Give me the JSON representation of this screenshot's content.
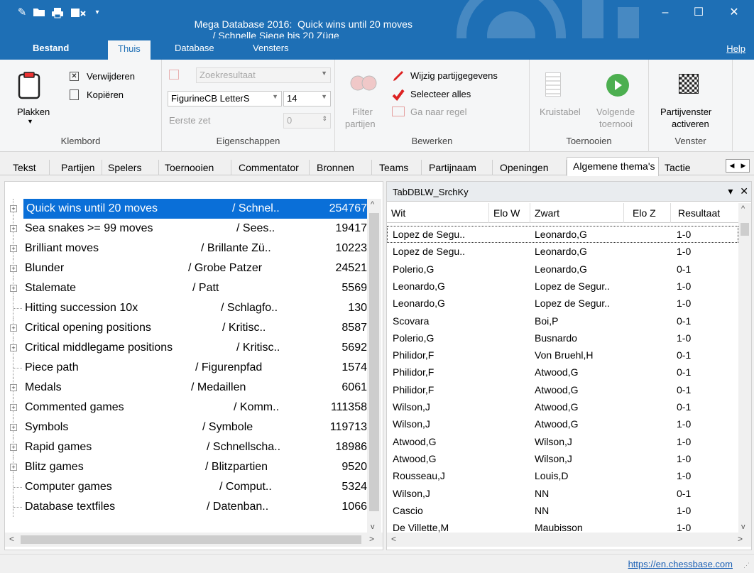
{
  "window": {
    "title": "Mega Database 2016:  Quick wins until 20 moves",
    "title_suffix": "/ Schnelle Siege bis 20 Züge",
    "minimize": "–",
    "maximize": "☐",
    "close": "✕"
  },
  "quick_access": {
    "edit_icon": "✎",
    "open_icon": "📂",
    "print_icon": "🖶",
    "more_icon": "▾"
  },
  "menu": {
    "tabs": [
      "Bestand",
      "Thuis",
      "Database",
      "Vensters"
    ],
    "active": "Thuis",
    "help": "Help"
  },
  "ribbon": {
    "clipboard": {
      "paste": "Plakken",
      "delete": "Verwijderen",
      "copy": "Kopiëren",
      "group": "Klembord"
    },
    "properties": {
      "search_result": "Zoekresultaat",
      "font": "FigurineCB LetterS",
      "font_size": "14",
      "first_move": "Eerste zet",
      "first_move_value": "0",
      "group": "Eigenschappen"
    },
    "edit": {
      "filter_line1": "Filter",
      "filter_line2": "partijen",
      "edit_game_data": "Wijzig partijgegevens",
      "select_all": "Selecteer alles",
      "goto_line": "Ga naar regel",
      "group": "Bewerken"
    },
    "tournaments": {
      "crosstable": "Kruistabel",
      "next_line1": "Volgende",
      "next_line2": "toernooi",
      "group": "Toernooien"
    },
    "window": {
      "activate_line1": "Partijvenster",
      "activate_line2": "activeren",
      "group": "Venster"
    }
  },
  "content_tabs": [
    "Tekst",
    "Partijen",
    "Spelers",
    "Toernooien",
    "Commentator",
    "Bronnen",
    "Teams",
    "Partijnaam",
    "Openingen",
    "Algemene thema's",
    "Tactie"
  ],
  "active_content_tab": "Algemene thema's",
  "tree": [
    {
      "name": "Quick wins until 20 moves",
      "de": "/ Schnel..",
      "count": "254767",
      "expandable": true,
      "selected": true
    },
    {
      "name": "Sea snakes >= 99 moves",
      "de": "/ Sees..",
      "count": "19417",
      "expandable": true
    },
    {
      "name": "Brilliant moves",
      "de": "/ Brillante Zü..",
      "count": "10223",
      "expandable": true
    },
    {
      "name": "Blunder",
      "de": "/ Grobe Patzer",
      "count": "24521",
      "expandable": true
    },
    {
      "name": "Stalemate",
      "de": "/ Patt",
      "count": "5569",
      "expandable": true
    },
    {
      "name": "Hitting succession 10x",
      "de": "/ Schlagfo..",
      "count": "130",
      "expandable": false
    },
    {
      "name": "Critical opening positions",
      "de": "/ Kritisc..",
      "count": "8587",
      "expandable": true
    },
    {
      "name": "Critical middlegame positions",
      "de": "/ Kritisc..",
      "count": "5692",
      "expandable": true
    },
    {
      "name": "Piece path",
      "de": "/ Figurenpfad",
      "count": "1574",
      "expandable": false
    },
    {
      "name": "Medals",
      "de": "/ Medaillen",
      "count": "6061",
      "expandable": true
    },
    {
      "name": "Commented games",
      "de": "/ Komm..",
      "count": "111358",
      "expandable": true
    },
    {
      "name": "Symbols",
      "de": "/ Symbole",
      "count": "119713",
      "expandable": true
    },
    {
      "name": "Rapid games",
      "de": "/ Schnellscha..",
      "count": "18986",
      "expandable": true
    },
    {
      "name": "Blitz games",
      "de": "/ Blitzpartien",
      "count": "9520",
      "expandable": true
    },
    {
      "name": "Computer games",
      "de": "/ Comput..",
      "count": "5324",
      "expandable": false
    },
    {
      "name": "Database textfiles",
      "de": "/ Datenban..",
      "count": "1066",
      "expandable": false
    }
  ],
  "games_panel": {
    "title": "TabDBLW_SrchKy",
    "columns": [
      "Wit",
      "Elo W",
      "Zwart",
      "Elo Z",
      "Resultaat"
    ],
    "rows": [
      [
        "Lopez de Segu..",
        "",
        "Leonardo,G",
        "",
        "1-0"
      ],
      [
        "Lopez de Segu..",
        "",
        "Leonardo,G",
        "",
        "1-0"
      ],
      [
        "Polerio,G",
        "",
        "Leonardo,G",
        "",
        "0-1"
      ],
      [
        "Leonardo,G",
        "",
        "Lopez de Segur..",
        "",
        "1-0"
      ],
      [
        "Leonardo,G",
        "",
        "Lopez de Segur..",
        "",
        "1-0"
      ],
      [
        "Scovara",
        "",
        "Boi,P",
        "",
        "0-1"
      ],
      [
        "Polerio,G",
        "",
        "Busnardo",
        "",
        "1-0"
      ],
      [
        "Philidor,F",
        "",
        "Von Bruehl,H",
        "",
        "0-1"
      ],
      [
        "Philidor,F",
        "",
        "Atwood,G",
        "",
        "0-1"
      ],
      [
        "Philidor,F",
        "",
        "Atwood,G",
        "",
        "0-1"
      ],
      [
        "Wilson,J",
        "",
        "Atwood,G",
        "",
        "0-1"
      ],
      [
        "Wilson,J",
        "",
        "Atwood,G",
        "",
        "1-0"
      ],
      [
        "Atwood,G",
        "",
        "Wilson,J",
        "",
        "1-0"
      ],
      [
        "Atwood,G",
        "",
        "Wilson,J",
        "",
        "1-0"
      ],
      [
        "Rousseau,J",
        "",
        "Louis,D",
        "",
        "1-0"
      ],
      [
        "Wilson,J",
        "",
        "NN",
        "",
        "0-1"
      ],
      [
        "Cascio",
        "",
        "NN",
        "",
        "1-0"
      ],
      [
        "De Villette,M",
        "",
        "Maubisson",
        "",
        "1-0"
      ]
    ]
  },
  "status": {
    "link": "https://en.chessbase.com"
  },
  "colors": {
    "titlebar": "#1e6fb5",
    "selection": "#0a6fd8",
    "link": "#1a5fb4"
  }
}
